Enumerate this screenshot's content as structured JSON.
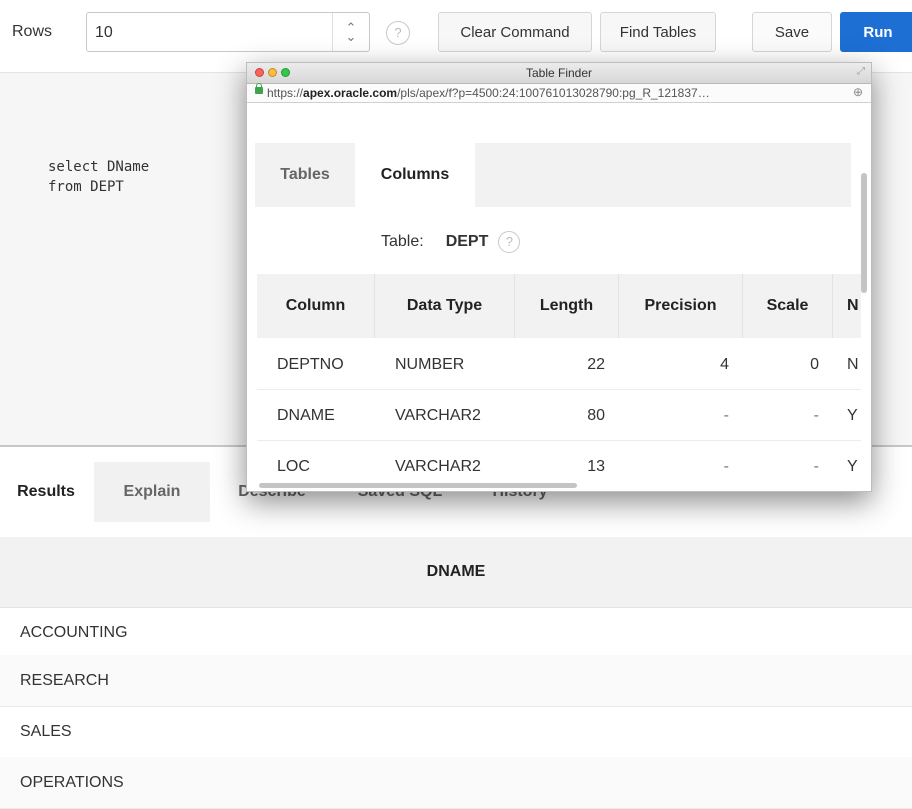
{
  "toolbar": {
    "rows_label": "Rows",
    "rows_value": "10",
    "clear_label": "Clear Command",
    "find_label": "Find Tables",
    "save_label": "Save",
    "run_label": "Run"
  },
  "editor": {
    "line1": "select DName",
    "line2": "from DEPT"
  },
  "results_tabs": [
    "Results",
    "Explain",
    "Describe",
    "Saved SQL",
    "History"
  ],
  "results": {
    "header": "DNAME",
    "rows": [
      "ACCOUNTING",
      "RESEARCH",
      "SALES",
      "OPERATIONS"
    ]
  },
  "popup": {
    "title": "Table Finder",
    "url_prefix": "https://",
    "url_host": "apex.oracle.com",
    "url_path": "/pls/apex/f?p=4500:24:100761013028790:pg_R_121837…",
    "tabs": [
      "Tables",
      "Columns"
    ],
    "table_label": "Table:",
    "table_name": "DEPT",
    "columns": [
      "Column",
      "Data Type",
      "Length",
      "Precision",
      "Scale",
      "N"
    ],
    "rows": [
      [
        "DEPTNO",
        "NUMBER",
        "22",
        "4",
        "0",
        "N"
      ],
      [
        "DNAME",
        "VARCHAR2",
        "80",
        "-",
        "-",
        "Y"
      ],
      [
        "LOC",
        "VARCHAR2",
        "13",
        "-",
        "-",
        "Y"
      ]
    ]
  },
  "colors": {
    "run_button": "#1e6fd4",
    "editor_bg": "#f6f6f6"
  }
}
